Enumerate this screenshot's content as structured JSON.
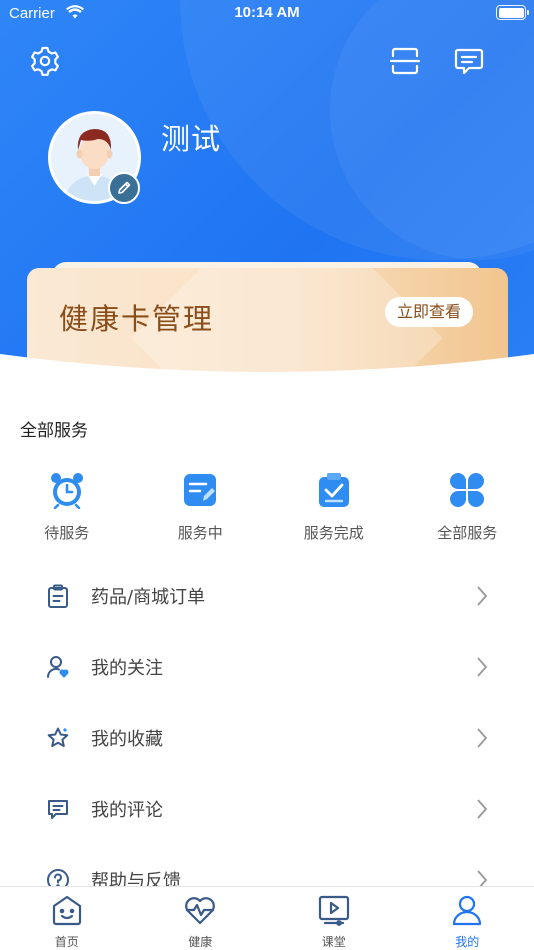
{
  "status_bar": {
    "carrier": "Carrier",
    "time": "10:14 AM"
  },
  "profile": {
    "name": "测试"
  },
  "health_card": {
    "title": "健康卡管理",
    "button": "立即查看"
  },
  "services": {
    "title": "全部服务",
    "items": [
      {
        "label": "待服务",
        "icon": "alarm-clock-icon"
      },
      {
        "label": "服务中",
        "icon": "document-edit-icon"
      },
      {
        "label": "服务完成",
        "icon": "clipboard-check-icon"
      },
      {
        "label": "全部服务",
        "icon": "four-leaf-grid-icon"
      }
    ]
  },
  "menu": [
    {
      "label": "药品/商城订单",
      "icon": "clipboard-icon"
    },
    {
      "label": "我的关注",
      "icon": "user-heart-icon"
    },
    {
      "label": "我的收藏",
      "icon": "star-icon"
    },
    {
      "label": "我的评论",
      "icon": "comment-icon"
    },
    {
      "label": "帮助与反馈",
      "icon": "help-icon"
    }
  ],
  "tabs": [
    {
      "label": "首页",
      "icon": "home-face-icon",
      "active": false
    },
    {
      "label": "健康",
      "icon": "heart-pulse-icon",
      "active": false
    },
    {
      "label": "课堂",
      "icon": "video-class-icon",
      "active": false
    },
    {
      "label": "我的",
      "icon": "user-icon",
      "active": true
    }
  ],
  "colors": {
    "primary": "#1f74f2",
    "card_text": "#8a4e1b",
    "icon_blue": "#2f8cf0",
    "menu_icon": "#3a5a8a"
  }
}
